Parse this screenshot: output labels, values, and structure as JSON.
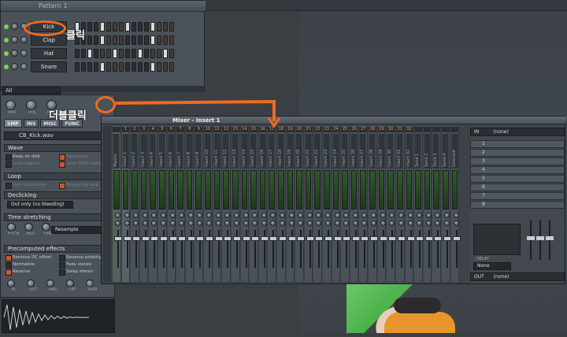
{
  "pattern": {
    "title": "Pattern 1",
    "channels": [
      {
        "name": "Kick",
        "steps": [
          1,
          0,
          0,
          0,
          1,
          0,
          0,
          0,
          1,
          0,
          0,
          0,
          1,
          0,
          0,
          0
        ]
      },
      {
        "name": "Clap",
        "steps": [
          0,
          0,
          0,
          0,
          1,
          0,
          0,
          0,
          0,
          0,
          0,
          0,
          1,
          0,
          0,
          0
        ]
      },
      {
        "name": "Hat",
        "steps": [
          0,
          0,
          1,
          0,
          0,
          0,
          1,
          0,
          0,
          0,
          1,
          0,
          0,
          0,
          1,
          0
        ]
      },
      {
        "name": "Snare",
        "steps": [
          0,
          0,
          0,
          0,
          1,
          0,
          0,
          0,
          0,
          0,
          0,
          0,
          1,
          0,
          0,
          0
        ]
      }
    ],
    "filter": "All"
  },
  "channel_settings": {
    "knobs": [
      "PAN",
      "VOL",
      "PITCH"
    ],
    "tabs": [
      "SMP",
      "INS",
      "MISC",
      "FUNC"
    ],
    "sample": "CB_Kick.wav",
    "wave": {
      "label": "Wave",
      "options": [
        {
          "label": "Keep on disk",
          "checked": false
        },
        {
          "label": "Resample",
          "checked": true,
          "dim": true
        },
        {
          "label": "Load regions",
          "checked": false,
          "dim": true
        },
        {
          "label": "Load ACID markers",
          "checked": true,
          "dim": true
        }
      ]
    },
    "loop": {
      "label": "Loop",
      "options": [
        {
          "label": "Use loop points",
          "checked": false,
          "dim": true
        },
        {
          "label": "Ping-pong loop",
          "checked": true,
          "dim": true
        }
      ]
    },
    "declicking": {
      "label": "Declicking",
      "value": "Out only (no bleeding)"
    },
    "time_stretching": {
      "label": "Time stretching",
      "knobs": [
        "PITCH",
        "MUL",
        "TIME"
      ],
      "mode": "Resample"
    },
    "precomputed": {
      "label": "Precomputed effects",
      "options": [
        {
          "label": "Remove DC offset",
          "checked": true
        },
        {
          "label": "Reverse polarity",
          "checked": false
        },
        {
          "label": "Normalize",
          "checked": false
        },
        {
          "label": "Fade stereo",
          "checked": false
        },
        {
          "label": "Reverse",
          "checked": true
        },
        {
          "label": "Swap stereo",
          "checked": false
        }
      ],
      "knobs": [
        "IN",
        "OUT",
        "PAN",
        "CRF",
        "TRIM"
      ]
    }
  },
  "mixer": {
    "title": "Mixer - Insert 1",
    "strips": [
      {
        "num": "",
        "name": "Master"
      },
      {
        "num": "1",
        "name": "Insert 1"
      },
      {
        "num": "2",
        "name": "Insert 2"
      },
      {
        "num": "3",
        "name": "Insert 3"
      },
      {
        "num": "4",
        "name": "Insert 4"
      },
      {
        "num": "5",
        "name": "Insert 5"
      },
      {
        "num": "6",
        "name": "Insert 6"
      },
      {
        "num": "7",
        "name": "Insert 7"
      },
      {
        "num": "8",
        "name": "Insert 8"
      },
      {
        "num": "9",
        "name": "Insert 9"
      },
      {
        "num": "10",
        "name": "Insert 10"
      },
      {
        "num": "11",
        "name": "Insert 11"
      },
      {
        "num": "12",
        "name": "Insert 12"
      },
      {
        "num": "13",
        "name": "Insert 13"
      },
      {
        "num": "14",
        "name": "Insert 14"
      },
      {
        "num": "15",
        "name": "Insert 15"
      },
      {
        "num": "16",
        "name": "Insert 16"
      },
      {
        "num": "17",
        "name": "Insert 17"
      },
      {
        "num": "18",
        "name": "Insert 18"
      },
      {
        "num": "19",
        "name": "Insert 19"
      },
      {
        "num": "20",
        "name": "Insert 20"
      },
      {
        "num": "21",
        "name": "Insert 21"
      },
      {
        "num": "22",
        "name": "Insert 22"
      },
      {
        "num": "23",
        "name": "Insert 23"
      },
      {
        "num": "24",
        "name": "Insert 24"
      },
      {
        "num": "25",
        "name": "Insert 25"
      },
      {
        "num": "26",
        "name": "Insert 26"
      },
      {
        "num": "27",
        "name": "Insert 27"
      },
      {
        "num": "28",
        "name": "Insert 28"
      },
      {
        "num": "29",
        "name": "Insert 29"
      },
      {
        "num": "30",
        "name": "Insert 30"
      },
      {
        "num": "31",
        "name": "Insert 31"
      },
      {
        "num": "32",
        "name": "Insert 32"
      },
      {
        "num": "",
        "name": "Send 1"
      },
      {
        "num": "",
        "name": "Send 2"
      },
      {
        "num": "",
        "name": "Send 3"
      },
      {
        "num": "",
        "name": "Send 4"
      },
      {
        "num": "",
        "name": "Selected"
      }
    ],
    "in_label": "IN",
    "in_value": "(none)",
    "slots": [
      "1",
      "2",
      "3",
      "4",
      "5",
      "6",
      "7",
      "8"
    ],
    "out_label": "OUT",
    "out_value": "(none)",
    "delay_label": "DELAY",
    "delay_value": "None"
  },
  "annotations": {
    "click": "클릭",
    "double_click": "더블클릭"
  },
  "colors": {
    "accent_orange": "#f06a1e",
    "step_on": "#d9dde0",
    "led_green": "#7fd04a"
  }
}
